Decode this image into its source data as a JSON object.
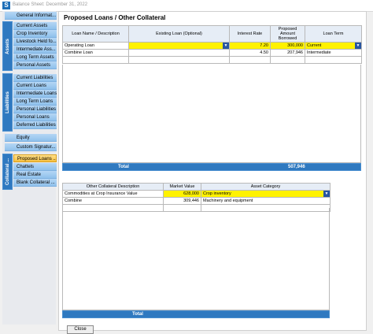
{
  "window": {
    "title": "Balance Sheet: December 31, 2022"
  },
  "sidebar": {
    "general_info": "General Informat...",
    "assets_label": "Assets",
    "assets": [
      "Current Assets",
      "Crop Inventory",
      "Livestock Held fo...",
      "Intermediate Ass...",
      "Long Term Assets",
      "Personal Assets"
    ],
    "liabilities_label": "Liabilities",
    "liabilities": [
      "Current Liabilities",
      "Current Loans",
      "Intermediate Loans",
      "Long Term Loans",
      "Personal Liabilities",
      "Personal Loans",
      "Deferred Liabilities"
    ],
    "equity": "Equity",
    "custom_signature": "Custom Signatur...",
    "collateral_label": "Collateral ...",
    "collateral": [
      "Proposed Loans ...",
      "Chattels",
      "Real Estate",
      "Blank Collateral ..."
    ]
  },
  "page": {
    "title": "Proposed Loans / Other Collateral"
  },
  "loans_table": {
    "headers": {
      "name": "Loan Name / Description",
      "existing": "Existing Loan (Optional)",
      "rate": "Interest Rate",
      "amount": "Proposed Amount Borrowed",
      "term": "Loan Term"
    },
    "rows": [
      {
        "name": "Operating Loan",
        "existing": "",
        "rate": "7.20",
        "amount": "300,000",
        "term": "Current"
      },
      {
        "name": "Combine Loan",
        "existing": "",
        "rate": "4.50",
        "amount": "207,946",
        "term": "Intermediate"
      }
    ],
    "total_label": "Total",
    "total_value": "507,946"
  },
  "collateral_table": {
    "headers": {
      "desc": "Other Collateral Description",
      "value": "Market Value",
      "category": "Asset Category"
    },
    "rows": [
      {
        "desc": "Commodities at Crop Insurance Value",
        "value": "628,000",
        "category": "Crop inventory"
      },
      {
        "desc": "Combine",
        "value": "309,446",
        "category": "Machinery and equipment"
      }
    ],
    "total_label": "Total",
    "total_value": ""
  },
  "buttons": {
    "close": "Close"
  },
  "icons": {
    "app_logo": "S",
    "dropdown": "▼"
  },
  "colors": {
    "accent": "#2f79c0",
    "selected": "#fff200",
    "active_nav": "#f7c040"
  }
}
